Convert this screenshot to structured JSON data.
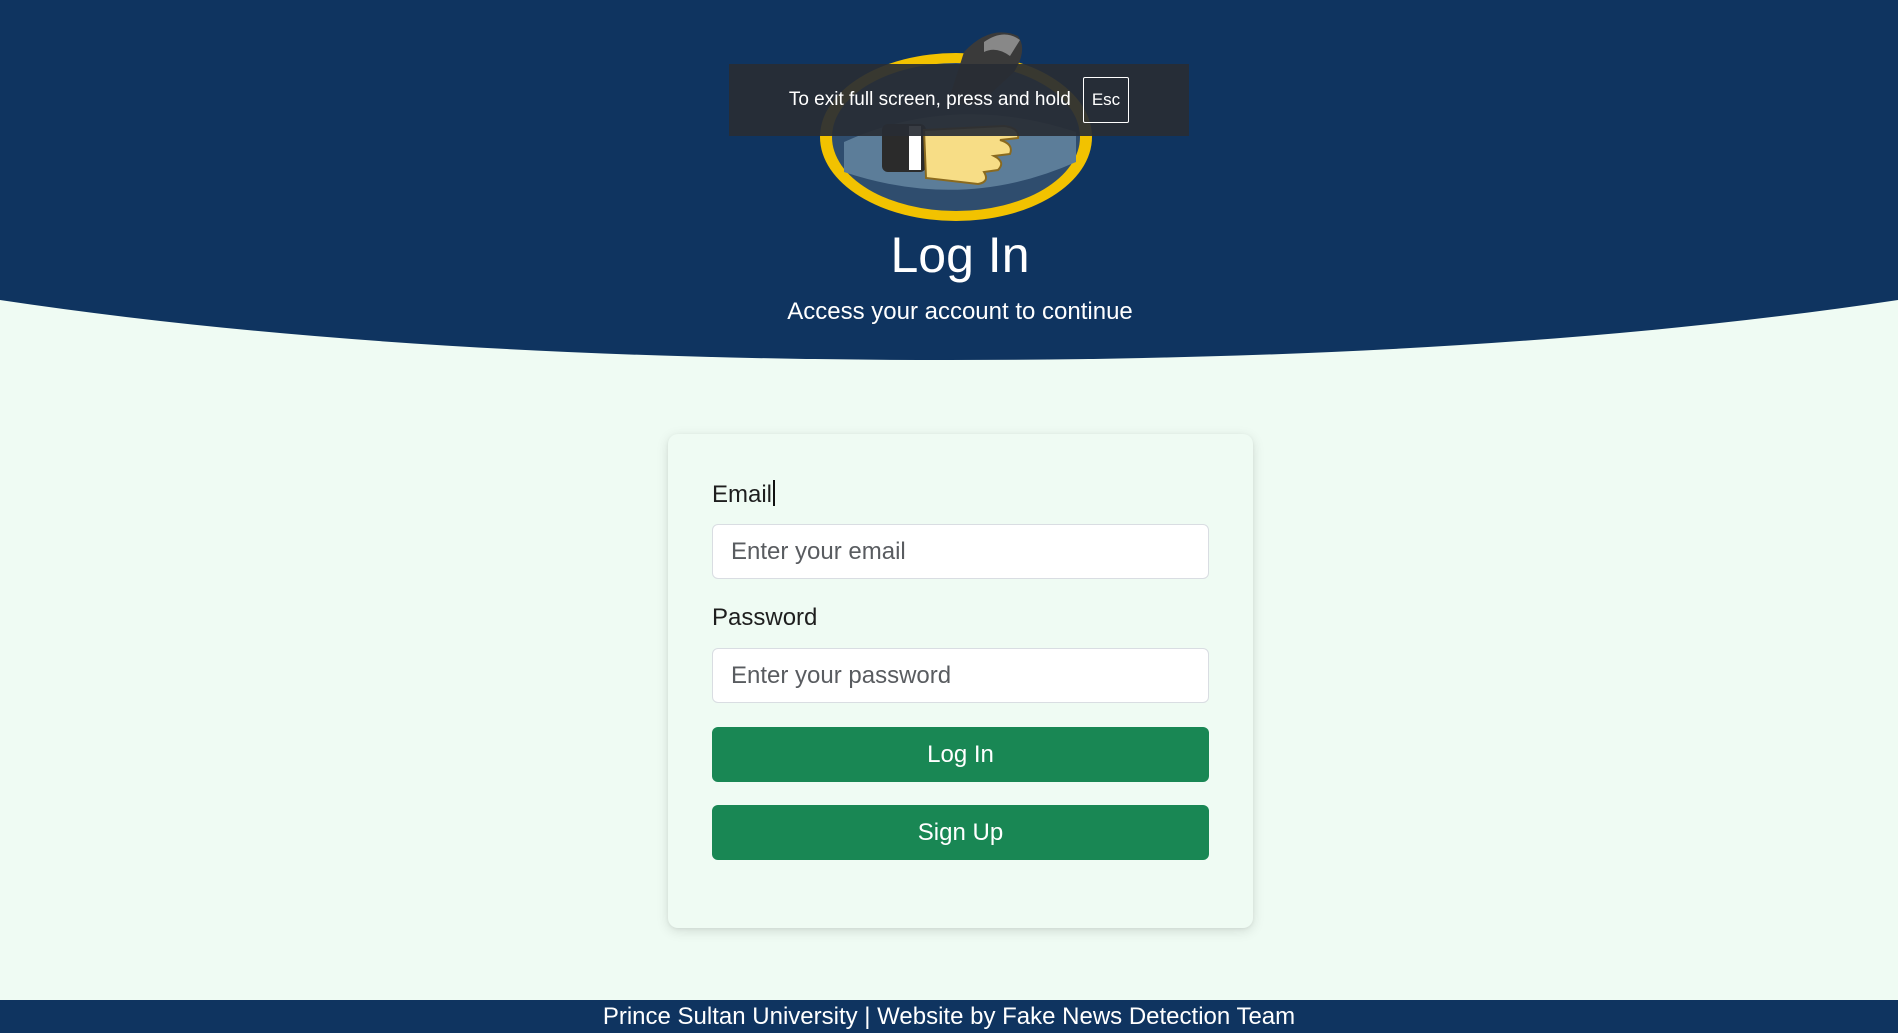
{
  "colors": {
    "header_bg": "#0f3460",
    "page_bg": "#effbf3",
    "button_bg": "#198754",
    "footer_bg": "#0f3460"
  },
  "fullscreen_notice": {
    "text": "To exit full screen, press and hold",
    "key": "Esc"
  },
  "header": {
    "logo_icon": "handshake-logo-icon",
    "title": "Log In",
    "subtitle": "Access your account to continue"
  },
  "form": {
    "email_label": "Email",
    "email_placeholder": "Enter your email",
    "password_label": "Password",
    "password_placeholder": "Enter your password",
    "login_button": "Log In",
    "signup_button": "Sign Up"
  },
  "footer": {
    "text": "Prince Sultan University | Website by Fake News Detection Team"
  }
}
